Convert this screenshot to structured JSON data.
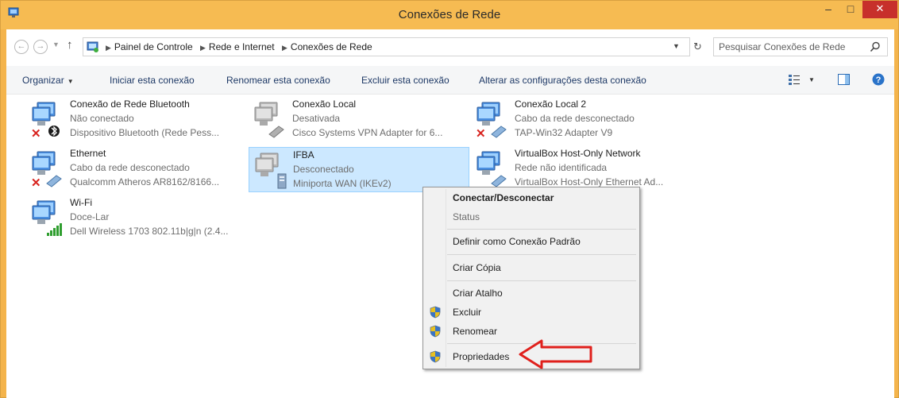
{
  "window": {
    "title": "Conexões de Rede",
    "minimize": "–",
    "maximize": "□",
    "close": "✕"
  },
  "address": {
    "crumbs": [
      "Painel de Controle",
      "Rede e Internet",
      "Conexões de Rede"
    ],
    "search_placeholder": "Pesquisar Conexões de Rede"
  },
  "toolbar": {
    "organize": "Organizar",
    "start": "Iniciar esta conexão",
    "rename": "Renomear esta conexão",
    "delete": "Excluir esta conexão",
    "change_settings": "Alterar as configurações desta conexão"
  },
  "connections": [
    {
      "name": "Conexão de Rede Bluetooth",
      "status": "Não conectado",
      "device": "Dispositivo Bluetooth (Rede Pess..."
    },
    {
      "name": "Conexão Local",
      "status": "Desativada",
      "device": "Cisco Systems VPN Adapter for 6..."
    },
    {
      "name": "Conexão Local 2",
      "status": "Cabo da rede desconectado",
      "device": "TAP-Win32 Adapter V9"
    },
    {
      "name": "Ethernet",
      "status": "Cabo da rede desconectado",
      "device": "Qualcomm Atheros AR8162/8166..."
    },
    {
      "name": "IFBA",
      "status": "Desconectado",
      "device": "Miniporta WAN (IKEv2)"
    },
    {
      "name": "VirtualBox Host-Only Network",
      "status": "Rede não identificada",
      "device": "VirtualBox Host-Only Ethernet Ad..."
    },
    {
      "name": "Wi-Fi",
      "status": "Doce-Lar",
      "device": "Dell Wireless 1703 802.11b|g|n (2.4..."
    }
  ],
  "context_menu": {
    "connect": "Conectar/Desconectar",
    "status": "Status",
    "set_default": "Definir como Conexão Padrão",
    "copy": "Criar Cópia",
    "shortcut": "Criar Atalho",
    "delete": "Excluir",
    "rename": "Renomear",
    "properties": "Propriedades"
  },
  "colors": {
    "title_bar": "#f6bb52",
    "close_button": "#c7302b",
    "selection": "#cce8ff",
    "arrow": "#e0201c"
  }
}
